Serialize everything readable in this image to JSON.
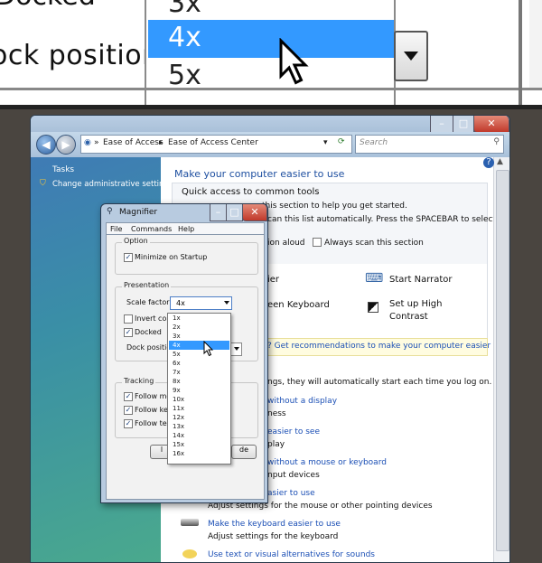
{
  "zoom": {
    "docked_fragment": "Docked",
    "dock_position_fragment": "ock position",
    "options": [
      "3x",
      "4x",
      "5x"
    ],
    "selected": "4x"
  },
  "eoa_window": {
    "breadcrumb": [
      "Ease of Access",
      "Ease of Access Center"
    ],
    "search_placeholder": "Search",
    "left_pane": {
      "tasks_heading": "Tasks",
      "change_admin_link": "Change administrative settings"
    },
    "main": {
      "heading": "Make your computer easier to use",
      "quick_access_heading": "Quick access to common tools",
      "quick_access_text": "this section to help you get started.",
      "scan_text": "can this list automatically.  Press the SPACEBAR to select the",
      "read_aloud": "ion aloud",
      "always_scan": "Always scan this section",
      "magnifier_frag": "ier",
      "start_narrator": "Start Narrator",
      "keyboard_frag": "een Keyboard",
      "high_contrast_1": "Set up High",
      "high_contrast_2": "Contrast",
      "recommendations_link": "? Get recommendations to make your computer easier to use",
      "logon_text": "ngs, they will automatically start each time you log on.",
      "without_display_link": "without a display",
      "ness_text": "ness",
      "easier_to_see_link": "easier to see",
      "play_text": "play",
      "mouse_keyboard_link": "without a mouse or keyboard",
      "input_devices_text": "nput devices",
      "use_link": "asier to use",
      "mouse_settings_text": "Adjust settings for the mouse or other pointing devices",
      "keyboard_link": "Make the keyboard easier to use",
      "keyboard_settings_text": "Adjust settings for the keyboard",
      "sounds_link": "Use text or visual alternatives for sounds"
    }
  },
  "magnifier": {
    "title": "Magnifier",
    "menu": [
      "File",
      "Commands",
      "Help"
    ],
    "option_group": "Option",
    "minimize_on_startup": "Minimize on Startup",
    "presentation_group": "Presentation",
    "scale_factor_label": "Scale factor:",
    "scale_factor_value": "4x",
    "invert_colors": "Invert colo",
    "docked": "Docked",
    "dock_position": "Dock position",
    "tracking_group": "Tracking",
    "follow_mouse": "Follow mo",
    "follow_keyboard": "Follow key",
    "follow_text": "Follow text",
    "btn_left_frag": "l",
    "btn_right_frag": "de"
  },
  "scale_options": [
    "1x",
    "2x",
    "3x",
    "4x",
    "5x",
    "6x",
    "7x",
    "8x",
    "9x",
    "10x",
    "11x",
    "12x",
    "13x",
    "14x",
    "15x",
    "16x"
  ],
  "scale_selected": "4x"
}
